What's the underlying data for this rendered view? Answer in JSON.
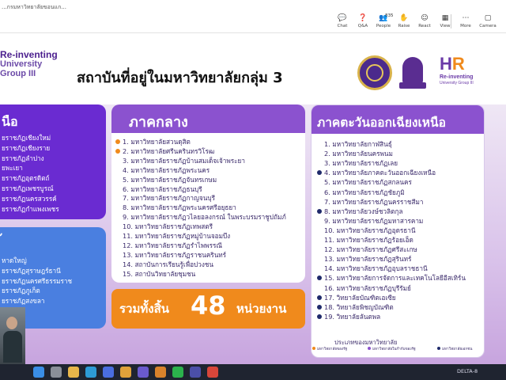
{
  "meeting": {
    "title": "...กรมหาวิทยาลัยขอนแก...",
    "toolbar": [
      {
        "id": "chat",
        "label": "Chat",
        "icon": "chat-icon",
        "glyph": "💬"
      },
      {
        "id": "qa",
        "label": "Q&A",
        "icon": "qa-icon",
        "glyph": "❓"
      },
      {
        "id": "people",
        "label": "People",
        "icon": "people-icon",
        "glyph": "👥",
        "count": "835"
      },
      {
        "id": "raise",
        "label": "Raise",
        "icon": "raise-hand-icon",
        "glyph": "✋"
      },
      {
        "id": "react",
        "label": "React",
        "icon": "react-icon",
        "glyph": "☺"
      },
      {
        "id": "view",
        "label": "View",
        "icon": "view-icon",
        "glyph": "▦"
      },
      {
        "id": "more",
        "label": "More",
        "icon": "more-icon",
        "glyph": "⋯"
      },
      {
        "id": "camera",
        "label": "Camera",
        "icon": "camera-icon",
        "glyph": "▢"
      }
    ]
  },
  "slide": {
    "logo_lines": [
      "Re-inventing",
      "University",
      "Group III"
    ],
    "title": "สถาบันที่อยู่ในมหาวิทยาลัยกลุ่ม 3",
    "hr_logo": {
      "letters_h": "H",
      "letters_r": "R",
      "sub1": "Re-inventing",
      "sub2": "University Group III"
    },
    "north": {
      "title": "นือ",
      "items": [
        "ยราชภัฏเชียงใหม่",
        "ยราชภัฏเชียงราย",
        "ยราชภัฏลำปาง",
        "ยพะเยา",
        "ยราชภัฏอุตรดิตถ์",
        "ยราชภัฏเพชรบูรณ์",
        "ยราชภัฏนครสวรรค์",
        "ยราชภัฏกำแพงเพชร"
      ]
    },
    "south": {
      "title": "้",
      "items": [
        "หาดใหญ่",
        "ยราชภัฏสุราษฎร์ธานี",
        "ยราชภัฏนครศรีธรรมราช",
        "ยราชภัฏภูเก็ต",
        "ยราชภัฏสงขลา",
        "ยะลา"
      ]
    },
    "central": {
      "title": "ภาคกลาง",
      "items": [
        {
          "text": "1. มหาวิทยาลัยสวนดุสิต",
          "dot": "orange"
        },
        {
          "text": "2. มหาวิทยาลัยศรีนครินทรวิโรฒ",
          "dot": "orange"
        },
        {
          "text": "3. มหาวิทยาลัยราชภัฏบ้านสมเด็จเจ้าพระยา",
          "dot": ""
        },
        {
          "text": "4. มหาวิทยาลัยราชภัฏพระนคร",
          "dot": ""
        },
        {
          "text": "5. มหาวิทยาลัยราชภัฏจันทรเกษม",
          "dot": ""
        },
        {
          "text": "6. มหาวิทยาลัยราชภัฏธนบุรี",
          "dot": ""
        },
        {
          "text": "7. มหาวิทยาลัยราชภัฏกาญจนบุรี",
          "dot": ""
        },
        {
          "text": "8. มหาวิทยาลัยราชภัฏพระนครศรีอยุธยา",
          "dot": ""
        },
        {
          "text": "9. มหาวิทยาลัยราชภัฏวไลยอลงกรณ์ ในพระบรมราชูปถัมภ์",
          "dot": ""
        },
        {
          "text": "10. มหาวิทยาลัยราชภัฏเทพสตรี",
          "dot": ""
        },
        {
          "text": "11. มหาวิทยาลัยราชภัฏหมู่บ้านจอมบึง",
          "dot": ""
        },
        {
          "text": "12. มหาวิทยาลัยราชภัฏรำไพพรรณี",
          "dot": ""
        },
        {
          "text": "13. มหาวิทยาลัยราชภัฏราชนครินทร์",
          "dot": ""
        },
        {
          "text": "14. สถาบันการเรียนรู้เพื่อปวงชน",
          "dot": ""
        },
        {
          "text": "15. สถาบันวิทยาลัยชุมชน",
          "dot": ""
        }
      ]
    },
    "northeast": {
      "title": "ภาคตะวันออกเฉียงเหนือ",
      "items": [
        {
          "text": "1. มหาวิทยาลัยกาฬสินธุ์",
          "dot": ""
        },
        {
          "text": "2. มหาวิทยาลัยนครพนม",
          "dot": ""
        },
        {
          "text": "3. มหาวิทยาลัยราชภัฏเลย",
          "dot": ""
        },
        {
          "text": "4. มหาวิทยาลัยภาคตะวันออกเฉียงเหนือ",
          "dot": "navy"
        },
        {
          "text": "5. มหาวิทยาลัยราชภัฏสกลนคร",
          "dot": ""
        },
        {
          "text": "6. มหาวิทยาลัยราชภัฏชัยภูมิ",
          "dot": ""
        },
        {
          "text": "7. มหาวิทยาลัยราชภัฏนครราชสีมา",
          "dot": ""
        },
        {
          "text": "8. มหาวิทยาลัยวงษ์ชวลิตกุล",
          "dot": "navy"
        },
        {
          "text": "9. มหาวิทยาลัยราชภัฏมหาสารคาม",
          "dot": ""
        },
        {
          "text": "10. มหาวิทยาลัยราชภัฏอุดรธานี",
          "dot": ""
        },
        {
          "text": "11. มหาวิทยาลัยราชภัฏร้อยเอ็ด",
          "dot": ""
        },
        {
          "text": "12. มหาวิทยาลัยราชภัฏศรีสะเกษ",
          "dot": ""
        },
        {
          "text": "13. มหาวิทยาลัยราชภัฏสุรินทร์",
          "dot": ""
        },
        {
          "text": "14. มหาวิทยาลัยราชภัฏอุบลราชธานี",
          "dot": ""
        },
        {
          "text": "15. มหาวิทยาลัยการจัดการและเทคโนโลยีอีสเทิร์น",
          "dot": "navy"
        },
        {
          "text": "16. มหาวิทยาลัยราชภัฏบุรีรัมย์",
          "dot": ""
        },
        {
          "text": "17. วิทยาลัยบัณฑิตเอเซีย",
          "dot": "navy"
        },
        {
          "text": "18. วิทยาลัยพิชญบัณฑิต",
          "dot": "navy"
        },
        {
          "text": "19. วิทยาลัยลันตพล",
          "dot": "navy"
        }
      ]
    },
    "total": {
      "label": "รวมทั้งสิ้น",
      "count": "48",
      "unit": "หน่วยงาน"
    },
    "legend": {
      "title": "ประเภทของมหาวิทยาลัย",
      "items": [
        {
          "text": "มหาวิทยาลัยของรัฐ",
          "color": "#f08a1c"
        },
        {
          "text": "มหาวิทยาลัยในกำกับของรัฐ",
          "color": "#8b52cf"
        },
        {
          "text": "มหาวิทยาลัยเอกชน",
          "color": "#1f2a6b"
        }
      ]
    }
  },
  "taskbar": {
    "system_text": "DELTA-8"
  },
  "colors": {
    "purple": "#8b52cf",
    "violet": "#6a2bd1",
    "blue": "#4a7fe0",
    "orange": "#f08a1c",
    "navy": "#1f2a6b"
  }
}
